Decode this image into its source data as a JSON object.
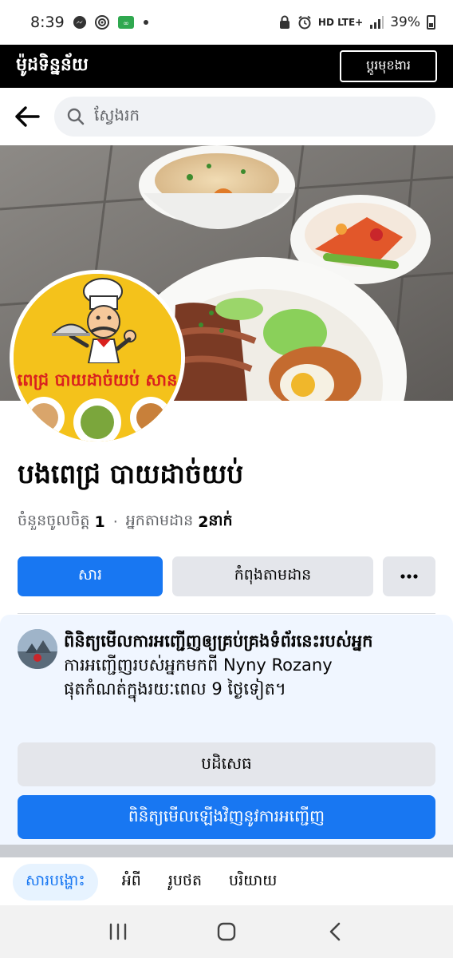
{
  "status_bar": {
    "time": "8:39",
    "network": "HD LTE+",
    "battery": "39%"
  },
  "mode_bar": {
    "title": "ម៉ូដទិន្នន័យ",
    "switch_label": "ប្ដូរមុខងារ"
  },
  "search": {
    "placeholder": "ស្វែងរក"
  },
  "page": {
    "name": "បងពេជ្រ បាយដាច់យប់",
    "logo_text": "ពេជ្រ បាយដាច់យប់ សាន",
    "likes_label": "ចំនួនចូលចិត្ត",
    "likes_count": "1",
    "followers_label": "អ្នកតាមដាន",
    "followers_count": "2",
    "followers_unit": "នាក់",
    "separator": "·"
  },
  "actions": {
    "message_label": "សារ",
    "following_label": "កំពុងតាមដាន",
    "more_label": "···"
  },
  "invite": {
    "title": "ពិនិត្យមើលការអញ្ជើញឲ្យគ្រប់គ្រងទំព័រនេះរបស់អ្នក",
    "line1": "ការអញ្ជើញរបស់អ្នកមកពី Nyny Rozany",
    "line2": "ផុតកំណត់ក្នុងរយៈពេល 9 ថ្ងៃទៀត។",
    "decline_label": "បដិសេធ",
    "review_label": "ពិនិត្យមើលឡើងវិញនូវការអញ្ជើញ"
  },
  "tabs": [
    {
      "label": "សារបង្ហោះ",
      "active": true
    },
    {
      "label": "អំពី",
      "active": false
    },
    {
      "label": "រូបថត",
      "active": false
    },
    {
      "label": "បរិយាយ",
      "active": false
    }
  ],
  "colors": {
    "accent": "#1877f2",
    "secondary_button": "#e4e6eb",
    "invite_background": "#f0f6ff",
    "mode_bar": "#000000"
  }
}
